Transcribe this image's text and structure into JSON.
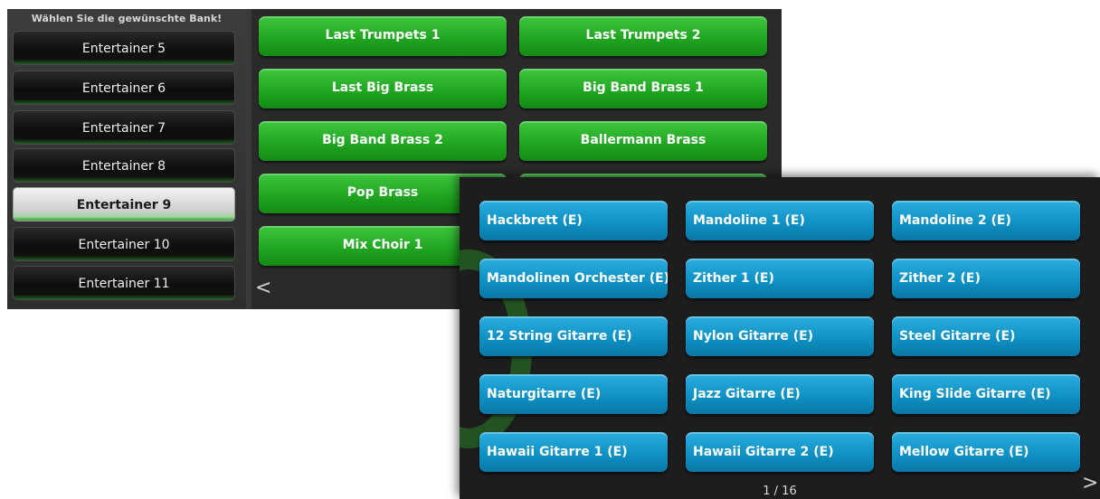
{
  "bank_panel": {
    "title": "Wählen Sie die gewünschte Bank!",
    "banks": [
      {
        "label": "Entertainer 5",
        "selected": false
      },
      {
        "label": "Entertainer 6",
        "selected": false
      },
      {
        "label": "Entertainer 7",
        "selected": false
      },
      {
        "label": "Entertainer 8",
        "selected": false
      },
      {
        "label": "Entertainer 9",
        "selected": true
      },
      {
        "label": "Entertainer 10",
        "selected": false
      },
      {
        "label": "Entertainer 11",
        "selected": false
      }
    ]
  },
  "green_voices": [
    "Last Trumpets 1",
    "Last Trumpets 2",
    "Last Big Brass",
    "Big Band Brass 1",
    "Big Band Brass 2",
    "Ballermann Brass",
    "Pop Brass",
    "Mix Choir 1"
  ],
  "blue_voices": [
    "Hackbrett (E)",
    "Mandoline 1 (E)",
    "Mandoline 2 (E)",
    "Mandolinen Orchester (E)",
    "Zither 1 (E)",
    "Zither 2 (E)",
    "12 String Gitarre (E)",
    "Nylon Gitarre (E)",
    "Steel Gitarre (E)",
    "Naturgitarre (E)",
    "Jazz Gitarre (E)",
    "King Slide Gitarre (E)",
    "Hawaii Gitarre 1 (E)",
    "Hawaii Gitarre 2 (E)",
    "Mellow Gitarre (E)"
  ],
  "nav": {
    "prev_arrow": "<",
    "next_arrow": ">",
    "page_indicator": "1 / 16"
  },
  "colors": {
    "green_button": "#1fa41f",
    "blue_button": "#0e8fc2",
    "selected_bank": "#e6e6e6",
    "panel_background": "#2b2b2b"
  }
}
